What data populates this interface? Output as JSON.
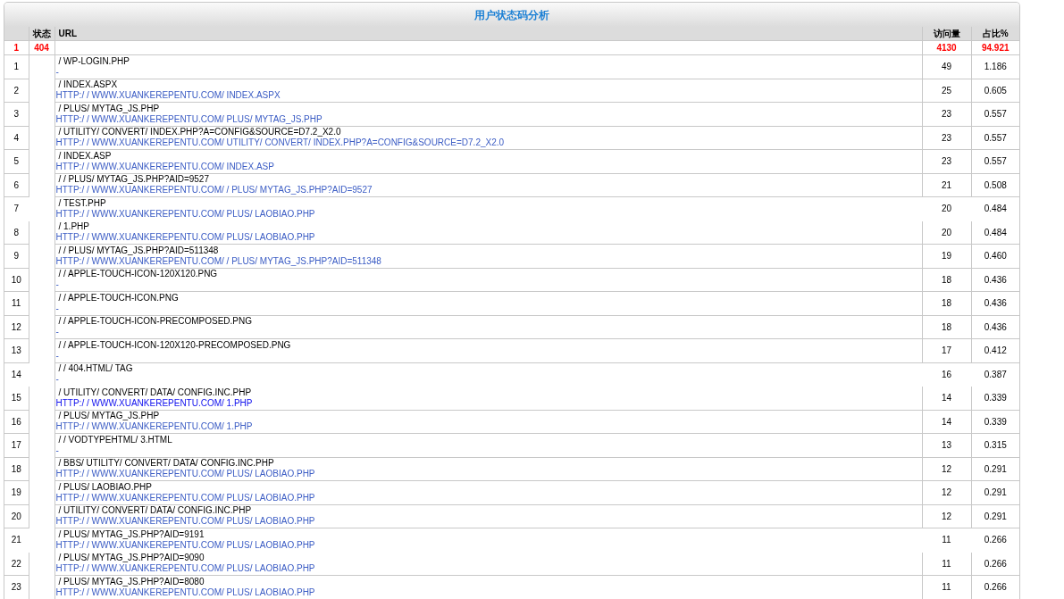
{
  "title": "用户状态码分析",
  "columns": {
    "status": "状态",
    "url": "URL",
    "visits": "访问量",
    "share": "占比%"
  },
  "summary": {
    "index": "1",
    "status": "404",
    "visits": "4130",
    "share": "94.921"
  },
  "rows": [
    {
      "index": "1",
      "path": "/ WP-LOGIN.PHP",
      "referrer": "-",
      "visited": true,
      "divider_below": true,
      "visits": "49",
      "share": "1.186"
    },
    {
      "index": "2",
      "path": "/ INDEX.ASPX",
      "referrer": "HTTP:/ / WWW.XUANKEREPENTU.COM/ INDEX.ASPX",
      "visited": true,
      "divider_below": true,
      "visits": "25",
      "share": "0.605"
    },
    {
      "index": "3",
      "path": "/ PLUS/ MYTAG_JS.PHP",
      "referrer": "HTTP:/ / WWW.XUANKEREPENTU.COM/ PLUS/ MYTAG_JS.PHP",
      "visited": true,
      "divider_below": true,
      "visits": "23",
      "share": "0.557"
    },
    {
      "index": "4",
      "path": "/ UTILITY/ CONVERT/ INDEX.PHP?A=CONFIG&SOURCE=D7.2_X2.0",
      "referrer": "HTTP:/ / WWW.XUANKEREPENTU.COM/ UTILITY/ CONVERT/ INDEX.PHP?A=CONFIG&SOURCE=D7.2_X2.0",
      "visited": true,
      "divider_below": true,
      "visits": "23",
      "share": "0.557"
    },
    {
      "index": "5",
      "path": "/ INDEX.ASP",
      "referrer": "HTTP:/ / WWW.XUANKEREPENTU.COM/ INDEX.ASP",
      "visited": true,
      "divider_below": true,
      "visits": "23",
      "share": "0.557"
    },
    {
      "index": "6",
      "path": "/ / PLUS/ MYTAG_JS.PHP?AID=9527",
      "referrer": "HTTP:/ / WWW.XUANKEREPENTU.COM/ / PLUS/ MYTAG_JS.PHP?AID=9527",
      "visited": true,
      "divider_below": true,
      "visits": "21",
      "share": "0.508"
    },
    {
      "index": "7",
      "path": "/ TEST.PHP",
      "referrer": "HTTP:/ / WWW.XUANKEREPENTU.COM/ PLUS/ LAOBIAO.PHP",
      "visited": true,
      "divider_below": false,
      "visits": "20",
      "share": "0.484"
    },
    {
      "index": "8",
      "path": "/ 1.PHP",
      "referrer": "HTTP:/ / WWW.XUANKEREPENTU.COM/ PLUS/ LAOBIAO.PHP",
      "visited": true,
      "divider_below": true,
      "visits": "20",
      "share": "0.484"
    },
    {
      "index": "9",
      "path": "/ / PLUS/ MYTAG_JS.PHP?AID=511348",
      "referrer": "HTTP:/ / WWW.XUANKEREPENTU.COM/ / PLUS/ MYTAG_JS.PHP?AID=511348",
      "visited": true,
      "divider_below": true,
      "visits": "19",
      "share": "0.460"
    },
    {
      "index": "10",
      "path": "/ / APPLE-TOUCH-ICON-120X120.PNG",
      "referrer": "-",
      "visited": true,
      "divider_below": true,
      "visits": "18",
      "share": "0.436"
    },
    {
      "index": "11",
      "path": "/ / APPLE-TOUCH-ICON.PNG",
      "referrer": "-",
      "visited": true,
      "divider_below": true,
      "visits": "18",
      "share": "0.436"
    },
    {
      "index": "12",
      "path": "/ / APPLE-TOUCH-ICON-PRECOMPOSED.PNG",
      "referrer": "-",
      "visited": true,
      "divider_below": true,
      "visits": "18",
      "share": "0.436"
    },
    {
      "index": "13",
      "path": "/ / APPLE-TOUCH-ICON-120X120-PRECOMPOSED.PNG",
      "referrer": "-",
      "visited": true,
      "divider_below": true,
      "visits": "17",
      "share": "0.412"
    },
    {
      "index": "14",
      "path": "/ / 404.HTML/ TAG",
      "referrer": "-",
      "visited": true,
      "divider_below": false,
      "visits": "16",
      "share": "0.387"
    },
    {
      "index": "15",
      "path": "/ UTILITY/ CONVERT/ DATA/ CONFIG.INC.PHP",
      "referrer": "HTTP:/ / WWW.XUANKEREPENTU.COM/ 1.PHP",
      "visited": false,
      "divider_below": true,
      "visits": "14",
      "share": "0.339"
    },
    {
      "index": "16",
      "path": "/ PLUS/ MYTAG_JS.PHP",
      "referrer": "HTTP:/ / WWW.XUANKEREPENTU.COM/ 1.PHP",
      "visited": true,
      "divider_below": true,
      "visits": "14",
      "share": "0.339"
    },
    {
      "index": "17",
      "path": "/ / VODTYPEHTML/ 3.HTML",
      "referrer": "-",
      "visited": true,
      "divider_below": true,
      "visits": "13",
      "share": "0.315"
    },
    {
      "index": "18",
      "path": "/ BBS/ UTILITY/ CONVERT/ DATA/ CONFIG.INC.PHP",
      "referrer": "HTTP:/ / WWW.XUANKEREPENTU.COM/ PLUS/ LAOBIAO.PHP",
      "visited": true,
      "divider_below": true,
      "visits": "12",
      "share": "0.291"
    },
    {
      "index": "19",
      "path": "/ PLUS/ LAOBIAO.PHP",
      "referrer": "HTTP:/ / WWW.XUANKEREPENTU.COM/ PLUS/ LAOBIAO.PHP",
      "visited": true,
      "divider_below": true,
      "visits": "12",
      "share": "0.291"
    },
    {
      "index": "20",
      "path": "/ UTILITY/ CONVERT/ DATA/ CONFIG.INC.PHP",
      "referrer": "HTTP:/ / WWW.XUANKEREPENTU.COM/ PLUS/ LAOBIAO.PHP",
      "visited": true,
      "divider_below": true,
      "visits": "12",
      "share": "0.291"
    },
    {
      "index": "21",
      "path": "/ PLUS/ MYTAG_JS.PHP?AID=9191",
      "referrer": "HTTP:/ / WWW.XUANKEREPENTU.COM/ PLUS/ LAOBIAO.PHP",
      "visited": true,
      "divider_below": false,
      "visits": "11",
      "share": "0.266"
    },
    {
      "index": "22",
      "path": "/ PLUS/ MYTAG_JS.PHP?AID=9090",
      "referrer": "HTTP:/ / WWW.XUANKEREPENTU.COM/ PLUS/ LAOBIAO.PHP",
      "visited": true,
      "divider_below": true,
      "visits": "11",
      "share": "0.266"
    },
    {
      "index": "23",
      "path": "/ PLUS/ MYTAG_JS.PHP?AID=8080",
      "referrer": "HTTP:/ / WWW.XUANKEREPENTU.COM/ PLUS/ LAOBIAO.PHP",
      "visited": true,
      "divider_below": true,
      "visits": "11",
      "share": "0.266"
    }
  ]
}
